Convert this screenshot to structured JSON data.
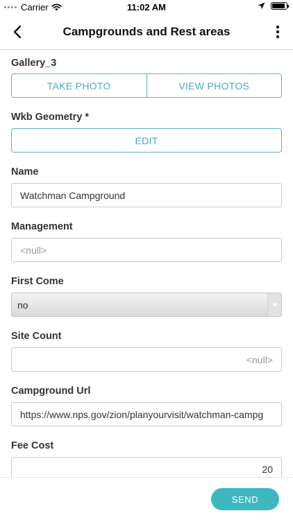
{
  "status_bar": {
    "carrier": "Carrier",
    "time": "11:02 AM",
    "battery_level": 0.9
  },
  "nav": {
    "title": "Campgrounds and Rest areas",
    "back_icon": "chevron-left-icon",
    "more_icon": "more-vertical-icon"
  },
  "form": {
    "gallery": {
      "label": "Gallery_3",
      "take_photo": "TAKE PHOTO",
      "view_photos": "VIEW PHOTOS"
    },
    "geometry": {
      "label": "Wkb Geometry *",
      "edit": "EDIT"
    },
    "name": {
      "label": "Name",
      "value": "Watchman Campground"
    },
    "management": {
      "label": "Management",
      "placeholder": "<null>"
    },
    "first_come": {
      "label": "First Come",
      "value": "no"
    },
    "site_count": {
      "label": "Site Count",
      "placeholder": "<null>"
    },
    "campground_url": {
      "label": "Campground Url",
      "value": "https://www.nps.gov/zion/planyourvisit/watchman-campg"
    },
    "fee_cost": {
      "label": "Fee Cost",
      "value": "20"
    }
  },
  "footer": {
    "send": "SEND"
  },
  "colors": {
    "accent": "#4aa8c0",
    "send_button": "#3fb7bf"
  }
}
